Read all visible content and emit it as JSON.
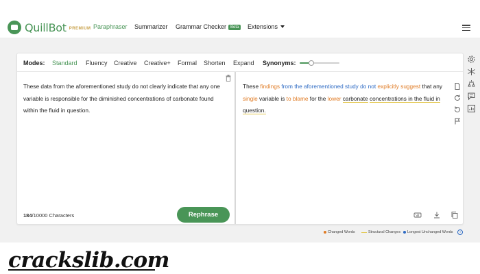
{
  "header": {
    "brand": "QuillBot",
    "brand_tier": "PREMIUM",
    "nav": [
      {
        "label": "Paraphraser",
        "active": true
      },
      {
        "label": "Summarizer",
        "active": false
      },
      {
        "label": "Grammar Checker",
        "active": false,
        "badge": "Beta"
      },
      {
        "label": "Extensions",
        "active": false,
        "dropdown": true
      }
    ],
    "menu_icon": "hamburger-icon"
  },
  "toolbar": {
    "modes_label": "Modes:",
    "modes": [
      "Standard",
      "Fluency",
      "Creative",
      "Creative+",
      "Formal",
      "Shorten",
      "Expand"
    ],
    "active_mode": "Standard",
    "synonyms_label": "Synonyms:",
    "synonyms_level": 0.3
  },
  "input": {
    "text": "These data from the aforementioned study do not clearly indicate that any one variable is responsible for the diminished concentrations of carbonate found within the fluid in question.",
    "char_count": "184",
    "char_limit_text": "/10000 Characters",
    "rephrase_label": "Rephrase"
  },
  "output": {
    "segments": [
      {
        "text": "These ",
        "type": "plain"
      },
      {
        "text": "findings",
        "type": "changed"
      },
      {
        "text": " ",
        "type": "plain"
      },
      {
        "text": "from the aforementioned study do not",
        "type": "longest"
      },
      {
        "text": " ",
        "type": "plain"
      },
      {
        "text": "explicitly suggest",
        "type": "changed"
      },
      {
        "text": " that any ",
        "type": "plain"
      },
      {
        "text": "single",
        "type": "changed"
      },
      {
        "text": " variable is ",
        "type": "plain"
      },
      {
        "text": "to blame",
        "type": "changed"
      },
      {
        "text": " for the ",
        "type": "plain"
      },
      {
        "text": "lower",
        "type": "changed"
      },
      {
        "text": " ",
        "type": "plain"
      },
      {
        "text": "carbonate",
        "type": "struct"
      },
      {
        "text": " ",
        "type": "plain"
      },
      {
        "text": "concentrations in the fluid in question.",
        "type": "struct"
      }
    ]
  },
  "legend": {
    "changed": "Changed Words",
    "structural": "Structural Changes",
    "longest": "Longest Unchanged Words"
  },
  "colors": {
    "brand": "#499557",
    "changed": "#e07b24",
    "structural": "#e3c84f",
    "longest": "#2e6bc4"
  },
  "watermark": "crackslib.com"
}
